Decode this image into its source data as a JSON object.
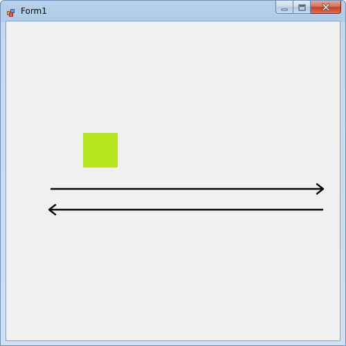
{
  "window": {
    "title": "Form1",
    "app_icon": "winforms-app-icon",
    "buttons": {
      "minimize": "minimize-icon",
      "maximize": "maximize-icon",
      "close": "close-icon"
    }
  },
  "canvas": {
    "background": "#f1f1f1",
    "square_color": "#b5e61d",
    "arrow_color": "#000000",
    "arrows": [
      {
        "direction": "right"
      },
      {
        "direction": "left"
      }
    ]
  }
}
